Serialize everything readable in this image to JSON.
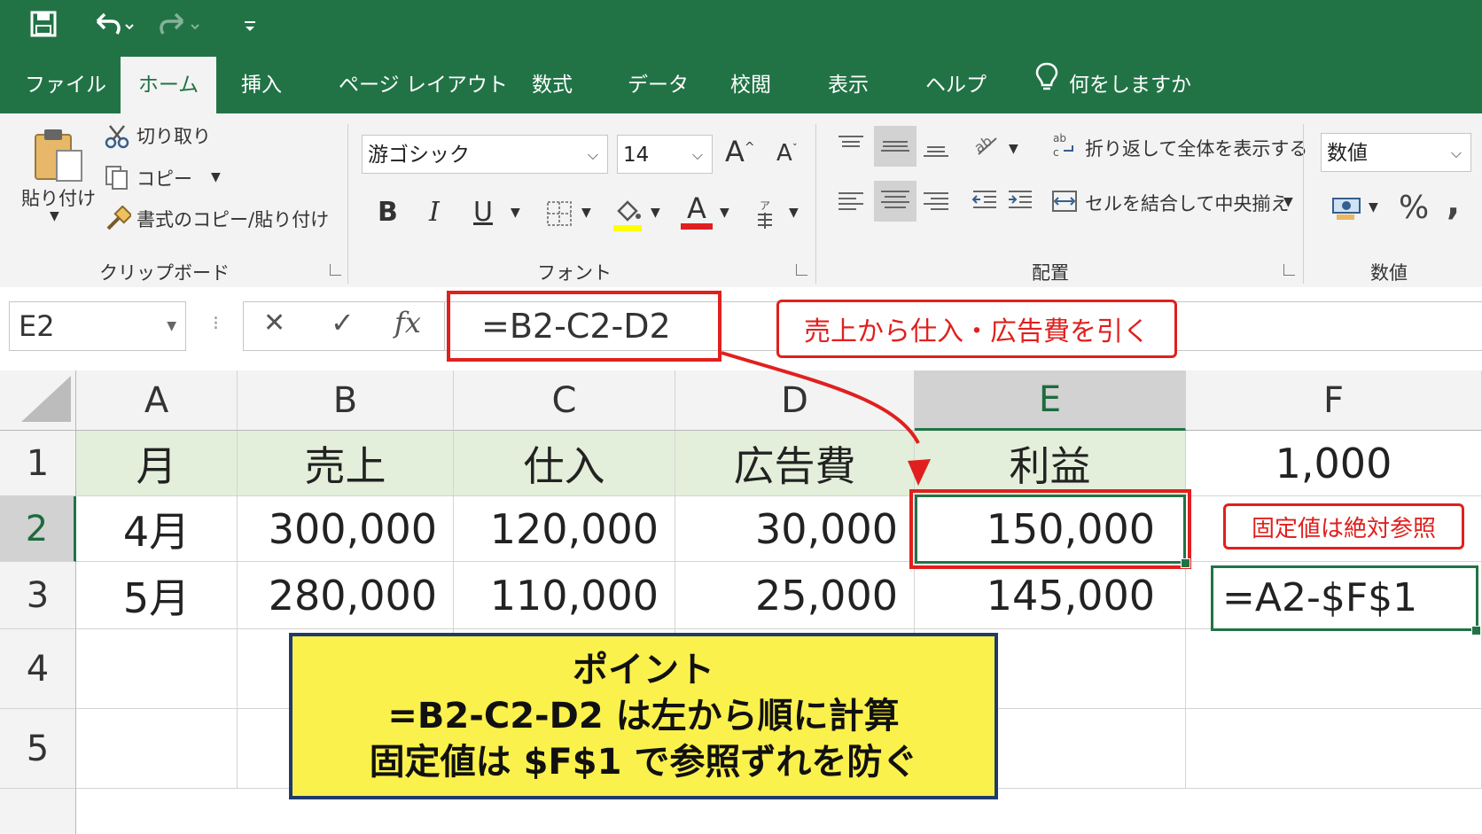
{
  "colors": {
    "excel_green": "#217346",
    "ribbon_bg": "#f3f3f3",
    "header_fill": "#e3efda",
    "annotation_red": "#e0201e",
    "point_yellow": "#fbf14c",
    "point_border": "#1f3a6b"
  },
  "qat": {
    "icons": [
      "save-icon",
      "undo-icon",
      "redo-icon",
      "customize-icon"
    ]
  },
  "tabs": [
    "ファイル",
    "ホーム",
    "挿入",
    "ページ レイアウト",
    "数式",
    "データ",
    "校閲",
    "表示",
    "ヘルプ"
  ],
  "active_tab": "ホーム",
  "tell_me": "何をしますか",
  "ribbon": {
    "clipboard": {
      "paste": "貼り付け",
      "cut": "切り取り",
      "copy": "コピー",
      "format_painter": "書式のコピー/貼り付け",
      "label": "クリップボード"
    },
    "font": {
      "name": "游ゴシック",
      "size": "14",
      "grow": "A",
      "shrink": "A",
      "bold": "B",
      "italic": "I",
      "underline": "U",
      "font_color_glyph": "A",
      "label": "フォント"
    },
    "alignment": {
      "wrap_text": "折り返して全体を表示する",
      "merge_center": "セルを結合して中央揃え",
      "label": "配置"
    },
    "number": {
      "format": "数値",
      "percent": "%",
      "comma": ",",
      "label": "数値"
    }
  },
  "formula_bar": {
    "name_box": "E2",
    "cancel": "✕",
    "enter": "✓",
    "fx": "fx",
    "formula": "=B2-C2-D2"
  },
  "annotations": {
    "formula_note": "売上から仕入・広告費を引く",
    "fixed_note": "固定値は絶対参照",
    "point_title": "ポイント",
    "point_line1": "=B2-C2-D2 は左から順に計算",
    "point_line2": "固定値は $F$1 で参照ずれを防ぐ"
  },
  "sheet": {
    "columns": [
      "A",
      "B",
      "C",
      "D",
      "E",
      "F"
    ],
    "selected_column": "E",
    "rows": [
      "1",
      "2",
      "3",
      "4",
      "5"
    ],
    "selected_row": "2",
    "cells": {
      "A1": "月",
      "B1": "売上",
      "C1": "仕入",
      "D1": "広告費",
      "E1": "利益",
      "F1": "1,000",
      "A2": "4月",
      "B2": "300,000",
      "C2": "120,000",
      "D2": "30,000",
      "E2": "150,000",
      "A3": "5月",
      "B3": "280,000",
      "C3": "110,000",
      "D3": "25,000",
      "E3": "145,000",
      "F3": "=A2-$F$1"
    }
  }
}
